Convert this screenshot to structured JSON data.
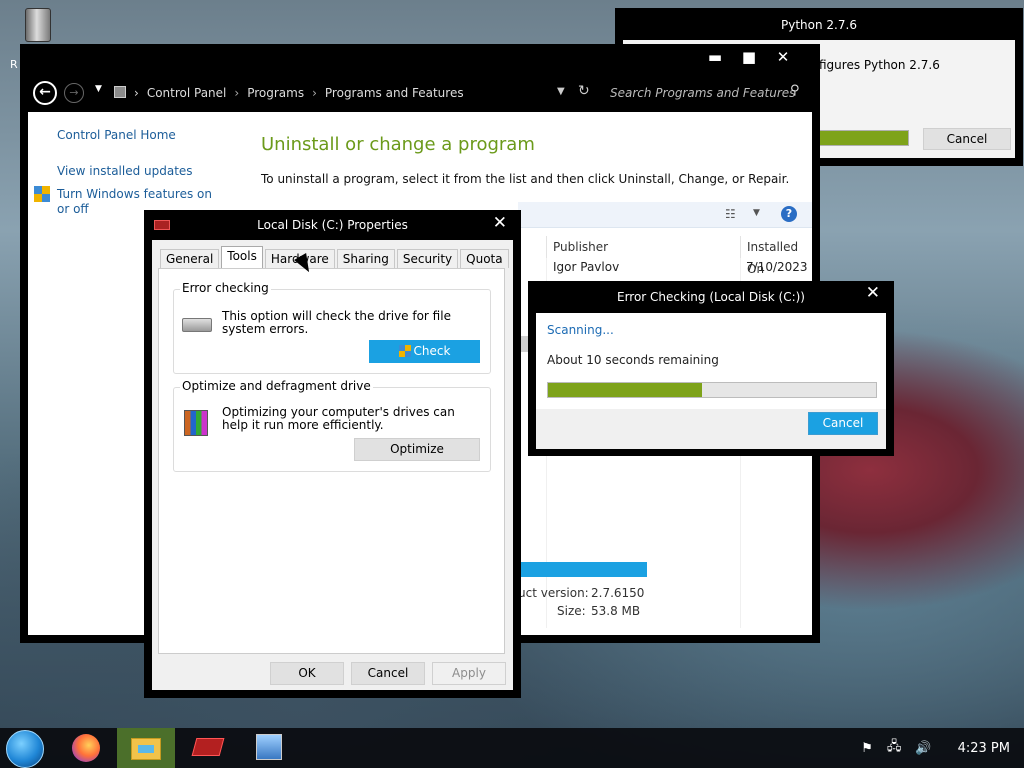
{
  "desktop": {
    "recycle_label": "R"
  },
  "python_window": {
    "title": "Python 2.7.6",
    "text": "figures Python 2.7.6",
    "progress": 0.95,
    "cancel_label": "Cancel"
  },
  "control_panel": {
    "caption_minimize": "▬",
    "caption_maximize": "■",
    "caption_close": "✕",
    "breadcrumbs": [
      "Control Panel",
      "Programs",
      "Programs and Features"
    ],
    "search_placeholder": "Search Programs and Features",
    "sidebar": {
      "home": "Control Panel Home",
      "updates": "View installed updates",
      "features": "Turn Windows features on or off"
    },
    "heading": "Uninstall or change a program",
    "subheading": "To uninstall a program, select it from the list and then click Uninstall, Change, or Repair.",
    "columns": {
      "publisher": "Publisher",
      "installed_on": "Installed On"
    },
    "rows": [
      {
        "publisher": "Igor Pavlov",
        "installed_on": "7/10/2023"
      }
    ],
    "details": {
      "version_label": "uct version:",
      "version_value": "2.7.6150",
      "size_label": "Size:",
      "size_value": "53.8 MB"
    }
  },
  "properties_dialog": {
    "title": "Local Disk (C:) Properties",
    "close": "✕",
    "tabs": [
      "General",
      "Tools",
      "Hardware",
      "Sharing",
      "Security",
      "Quota"
    ],
    "active_tab": "Tools",
    "error_checking": {
      "title": "Error checking",
      "text": "This option will check the drive for file system errors.",
      "button": "Check"
    },
    "optimize": {
      "title": "Optimize and defragment drive",
      "text": "Optimizing your computer's drives can help it run more efficiently.",
      "button": "Optimize"
    },
    "buttons": {
      "ok": "OK",
      "cancel": "Cancel",
      "apply": "Apply"
    }
  },
  "error_dialog": {
    "title": "Error Checking (Local Disk (C:))",
    "close": "✕",
    "status": "Scanning...",
    "remaining": "About 10 seconds remaining",
    "progress": 0.47,
    "cancel_label": "Cancel"
  },
  "taskbar": {
    "clock": "4:23 PM",
    "tray_flag": "⚑",
    "tray_network": "🖧",
    "tray_volume": "🔊"
  },
  "colors": {
    "accent_blue": "#1ba1e2",
    "progress_green": "#7ea31a",
    "heading_green": "#6b9a1a",
    "link_blue": "#1c5d99"
  }
}
